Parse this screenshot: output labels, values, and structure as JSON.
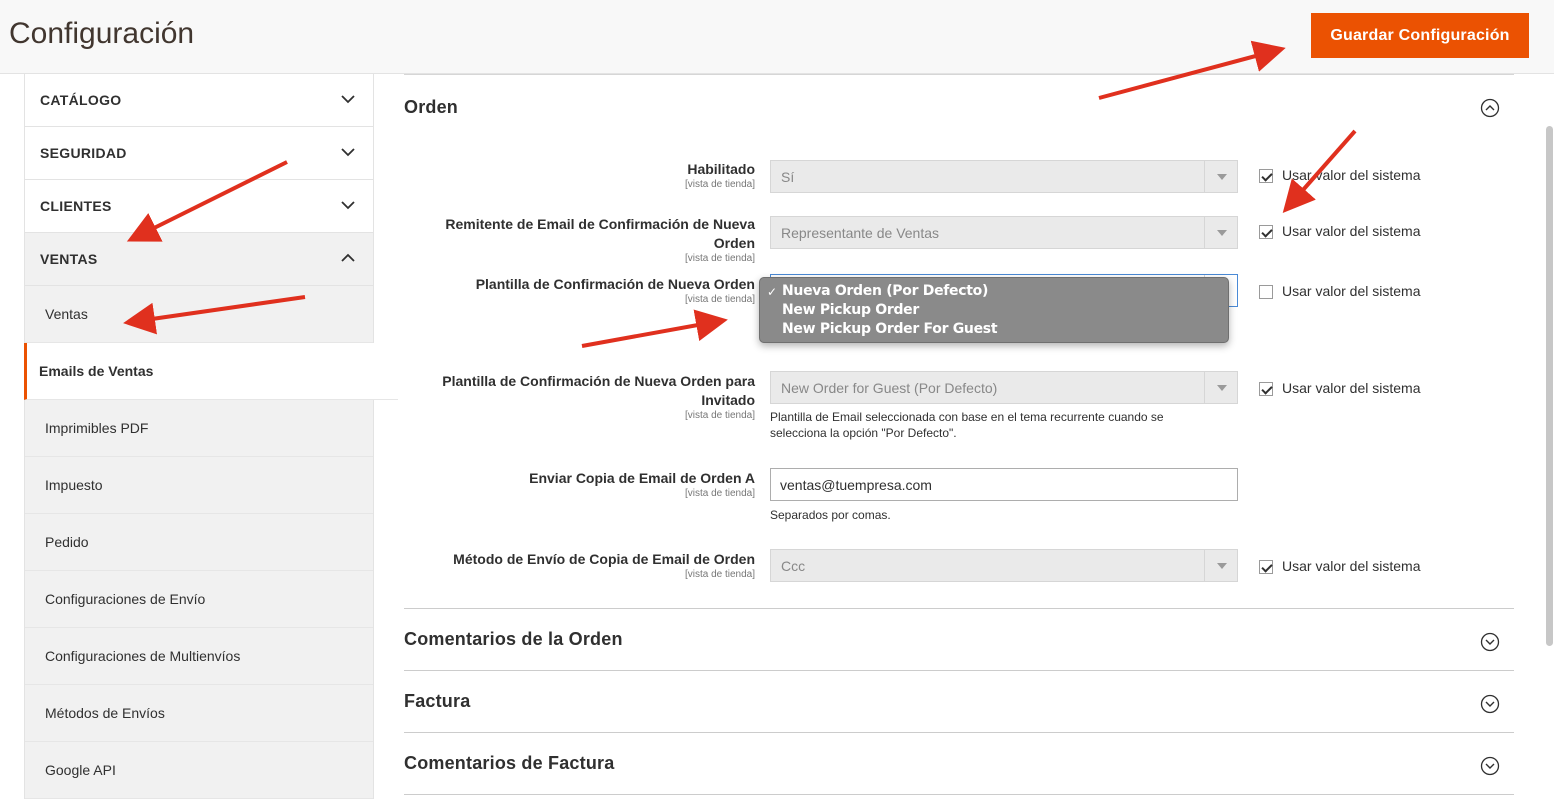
{
  "header": {
    "title": "Configuración",
    "save_label": "Guardar Configuración"
  },
  "sidebar": {
    "groups": [
      {
        "label": "CATÁLOGO"
      },
      {
        "label": "SEGURIDAD"
      },
      {
        "label": "CLIENTES"
      },
      {
        "label": "VENTAS"
      }
    ],
    "items": [
      {
        "label": "Ventas"
      },
      {
        "label": "Emails de Ventas"
      },
      {
        "label": "Imprimibles PDF"
      },
      {
        "label": "Impuesto"
      },
      {
        "label": "Pedido"
      },
      {
        "label": "Configuraciones de Envío"
      },
      {
        "label": "Configuraciones de Multienvíos"
      },
      {
        "label": "Métodos de Envíos"
      },
      {
        "label": "Google API"
      }
    ]
  },
  "section_orden": {
    "title": "Orden",
    "scope": "[vista de tienda]",
    "use_system": "Usar valor del sistema",
    "enabled": {
      "label": "Habilitado",
      "value": "Sí"
    },
    "sender": {
      "label_1": "Remitente de Email de Confirmación de Nueva",
      "label_2": "Orden",
      "value": "Representante de Ventas"
    },
    "template": {
      "label": "Plantilla de Confirmación de Nueva Orden",
      "options": [
        "Nueva Orden (Por Defecto)",
        "New Pickup Order",
        "New Pickup Order For Guest"
      ],
      "selected_mark": "✓"
    },
    "guest_template": {
      "label_1": "Plantilla de Confirmación de Nueva Orden para",
      "label_2": "Invitado",
      "value": "New Order for Guest (Por Defecto)",
      "note_1": "Plantilla de Email seleccionada con base en el tema recurrente cuando se",
      "note_2": "selecciona la opción \"Por Defecto\"."
    },
    "copy_to": {
      "label": "Enviar Copia de Email de Orden A",
      "value": "ventas@tuempresa.com",
      "note": "Separados por comas."
    },
    "copy_method": {
      "label": "Método de Envío de Copia de Email de Orden",
      "value": "Ccc"
    }
  },
  "sections": [
    {
      "title": "Comentarios de la Orden"
    },
    {
      "title": "Factura"
    },
    {
      "title": "Comentarios de Factura"
    }
  ],
  "colors": {
    "accent": "#eb5202",
    "annotation_arrow": "#e0301e"
  }
}
